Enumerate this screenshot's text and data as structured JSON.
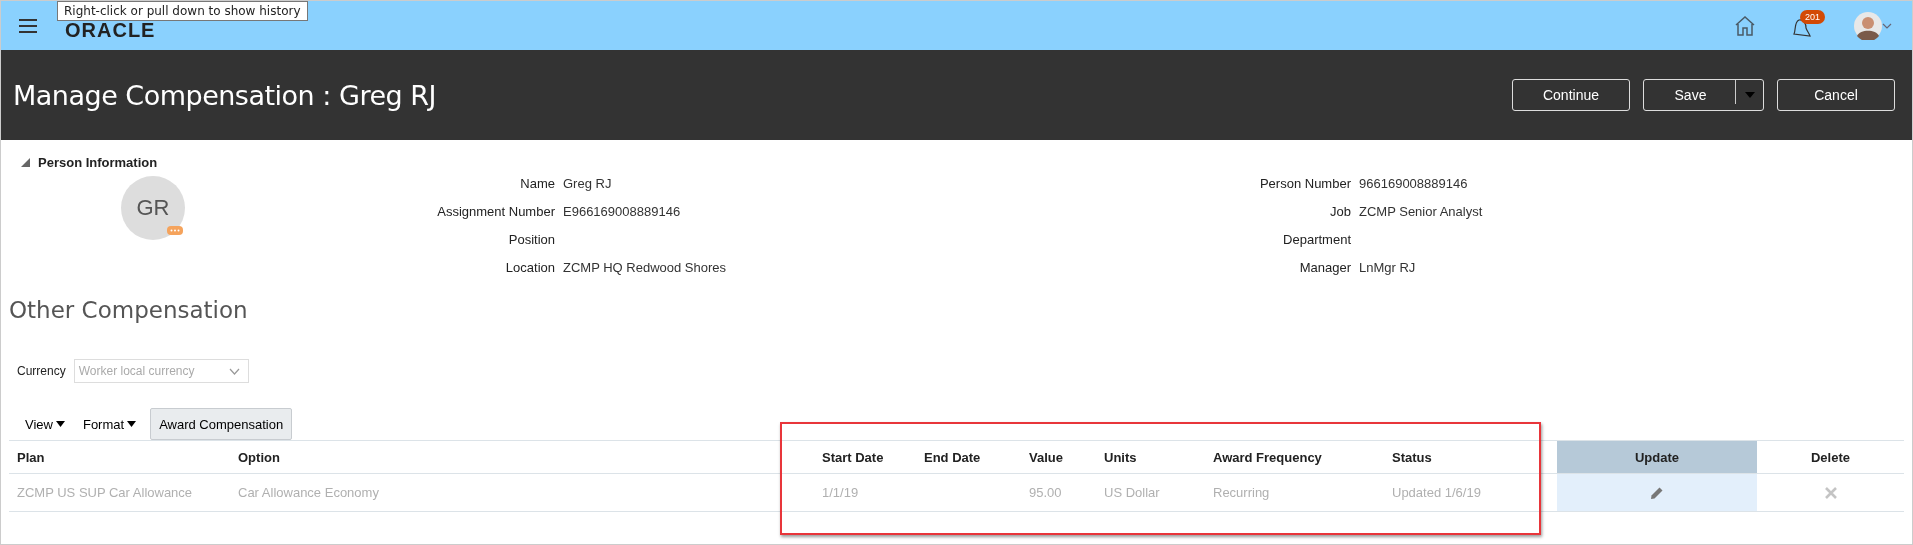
{
  "topbar": {
    "logo": "ORACLE",
    "tooltip": "Right-click or pull down to show history",
    "notification_count": "201"
  },
  "header": {
    "title": "Manage Compensation : Greg RJ",
    "buttons": [
      "Continue",
      "Save",
      "Cancel"
    ]
  },
  "person_information": {
    "title": "Person Information",
    "expanded": true,
    "initials": "GR",
    "left_fields": [
      {
        "label": "Name",
        "value": "Greg RJ"
      },
      {
        "label": "Assignment Number",
        "value": "E966169008889146"
      },
      {
        "label": "Position"
      },
      {
        "label": "Location",
        "value": "ZCMP HQ Redwood Shores"
      }
    ],
    "right_fields": [
      {
        "label": "Person Number",
        "value": "966169008889146"
      },
      {
        "label": "Job",
        "value": "ZCMP Senior Analyst"
      },
      {
        "label": "Department"
      },
      {
        "label": "Manager",
        "value": "LnMgr RJ"
      }
    ]
  },
  "section_title": "Other Compensation",
  "currency": {
    "label": "Currency",
    "value": "Worker local currency",
    "disabled": true
  },
  "toolbar": {
    "menus": [
      "View",
      "Format"
    ],
    "button": "Award Compensation"
  },
  "table": {
    "columns": [
      {
        "label": "Plan",
        "highlighted": false
      },
      {
        "label": "Option",
        "highlighted": false
      },
      {
        "label": "Start Date",
        "highlighted": false
      },
      {
        "label": "End Date",
        "highlighted": false
      },
      {
        "label": "Value",
        "highlighted": false
      },
      {
        "label": "Units",
        "highlighted": false
      },
      {
        "label": "Award Frequency",
        "highlighted": false
      },
      {
        "label": "Status",
        "highlighted": false
      },
      {
        "label": "Update",
        "highlighted": true
      },
      {
        "label": "Delete",
        "highlighted": false
      }
    ],
    "rows": [
      {
        "cells": [
          "ZCMP US SUP Car Allowance",
          "Car Allowance Economy",
          "1/1/19",
          "",
          "95.00",
          "US Dollar",
          "Recurring",
          "Updated 1/6/19"
        ],
        "delete_disabled": true
      }
    ]
  }
}
